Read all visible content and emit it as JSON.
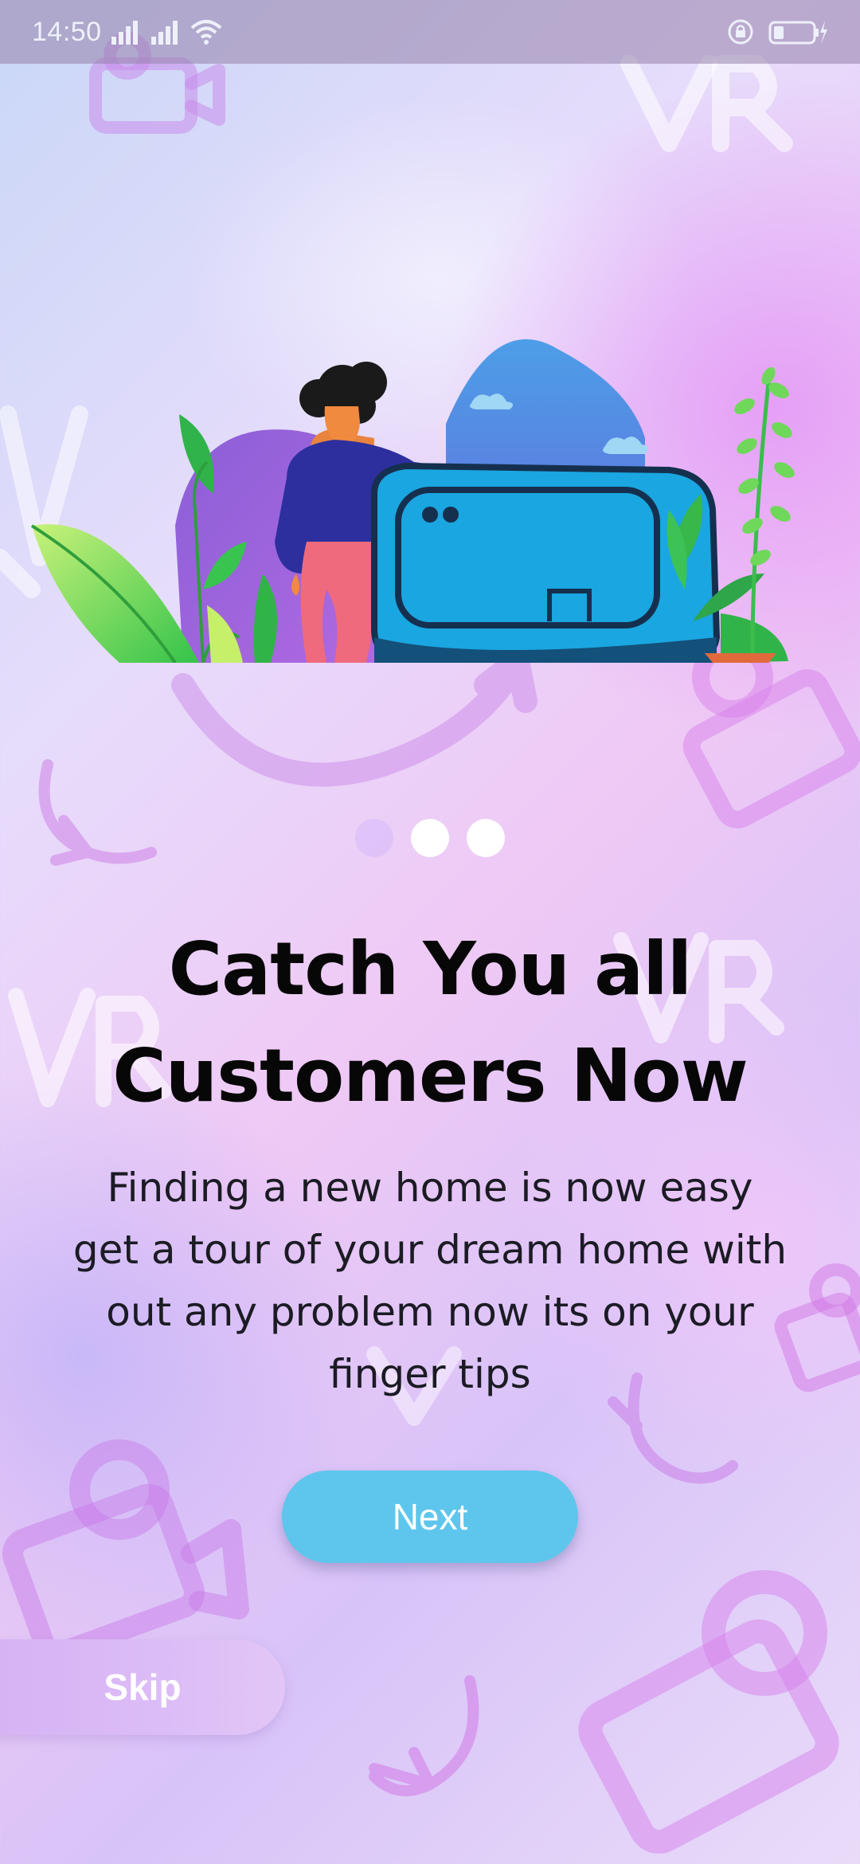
{
  "status_bar": {
    "time": "14:50",
    "icons": [
      "signal-icon",
      "signal-icon",
      "wifi-icon",
      "rotation-lock-icon",
      "battery-charging-icon"
    ]
  },
  "onboarding": {
    "illustration": "person-leaning-on-vr-headset-illustration",
    "pager": {
      "count": 3,
      "active_index": 0
    },
    "title": "Catch You all Customers Now",
    "description": "Finding a new home is now easy get a tour of your dream home with out any problem now its on your finger tips",
    "next_label": "Next",
    "skip_label": "Skip"
  },
  "colors": {
    "next_button": "#5ec6ec",
    "skip_button": "#d6b2f4",
    "title_text": "#070707",
    "indicator_dot": "#ffffff"
  }
}
